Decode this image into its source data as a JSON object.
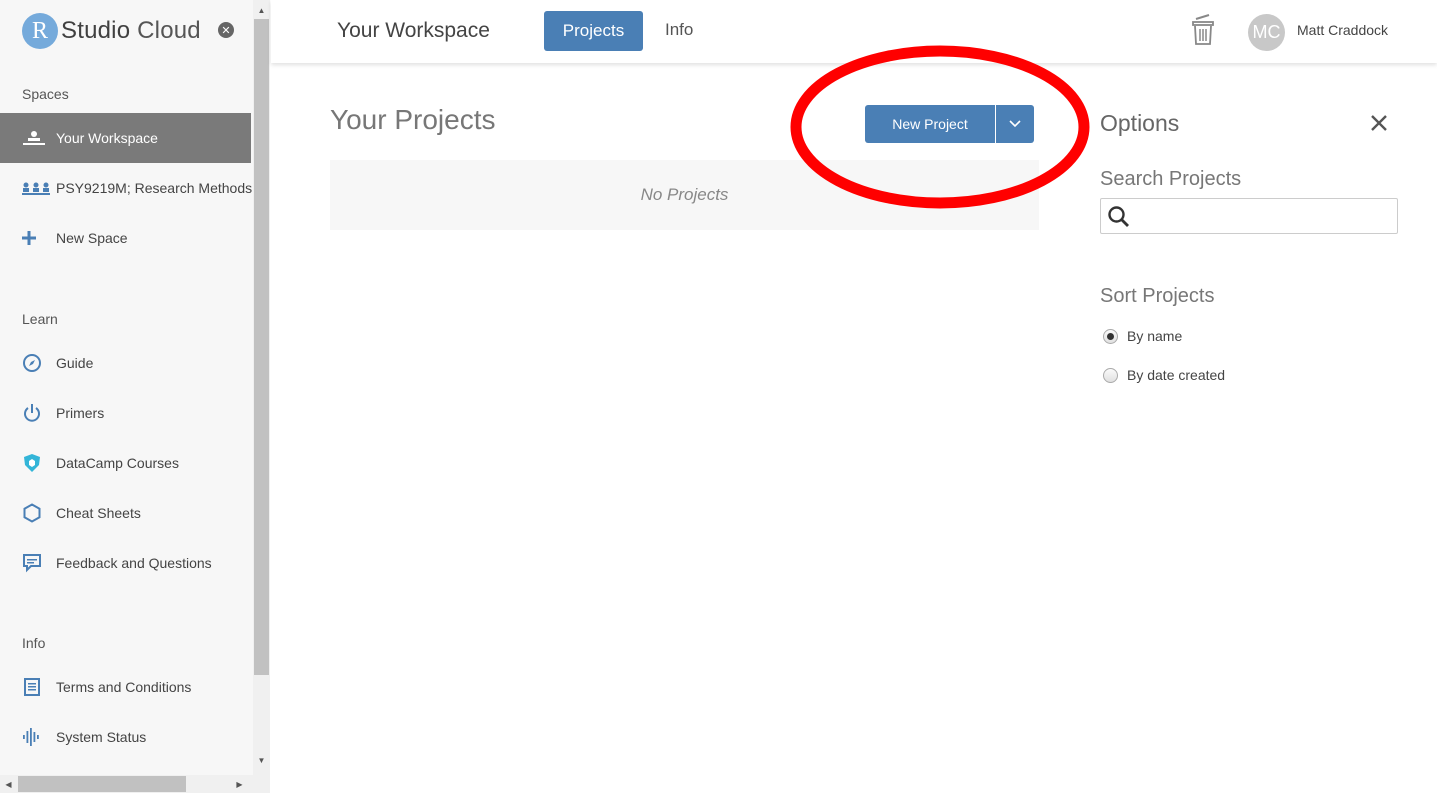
{
  "sidebar": {
    "logo": {
      "r": "R",
      "studio": "Studio",
      "cloud": "Cloud"
    },
    "spaces_heading": "Spaces",
    "spaces": [
      {
        "label": "Your Workspace",
        "icon": "workspace-icon",
        "active": true
      },
      {
        "label": "PSY9219M; Research Methods",
        "icon": "group-icon",
        "active": false
      },
      {
        "label": "New Space",
        "icon": "plus-icon",
        "active": false
      }
    ],
    "learn_heading": "Learn",
    "learn": [
      {
        "label": "Guide",
        "icon": "compass-icon"
      },
      {
        "label": "Primers",
        "icon": "power-icon"
      },
      {
        "label": "DataCamp Courses",
        "icon": "shield-icon"
      },
      {
        "label": "Cheat Sheets",
        "icon": "hexagon-icon"
      },
      {
        "label": "Feedback and Questions",
        "icon": "chat-icon"
      }
    ],
    "info_heading": "Info",
    "info": [
      {
        "label": "Terms and Conditions",
        "icon": "document-icon"
      },
      {
        "label": "System Status",
        "icon": "pulse-icon"
      }
    ]
  },
  "header": {
    "title": "Your Workspace",
    "tabs": {
      "projects": "Projects",
      "info": "Info"
    },
    "avatar_initials": "MC",
    "username": "Matt Craddock"
  },
  "main": {
    "heading": "Your Projects",
    "new_project_label": "New Project",
    "empty_text": "No Projects"
  },
  "options": {
    "title": "Options",
    "search_label": "Search Projects",
    "search_value": "",
    "sort_label": "Sort Projects",
    "sort_options": [
      {
        "label": "By name",
        "checked": true
      },
      {
        "label": "By date created",
        "checked": false
      }
    ]
  },
  "colors": {
    "accent": "#4a7fb5",
    "logo_circle": "#75aadb",
    "annotation": "#ff0000",
    "sidebar_active": "#7a7a7a"
  }
}
